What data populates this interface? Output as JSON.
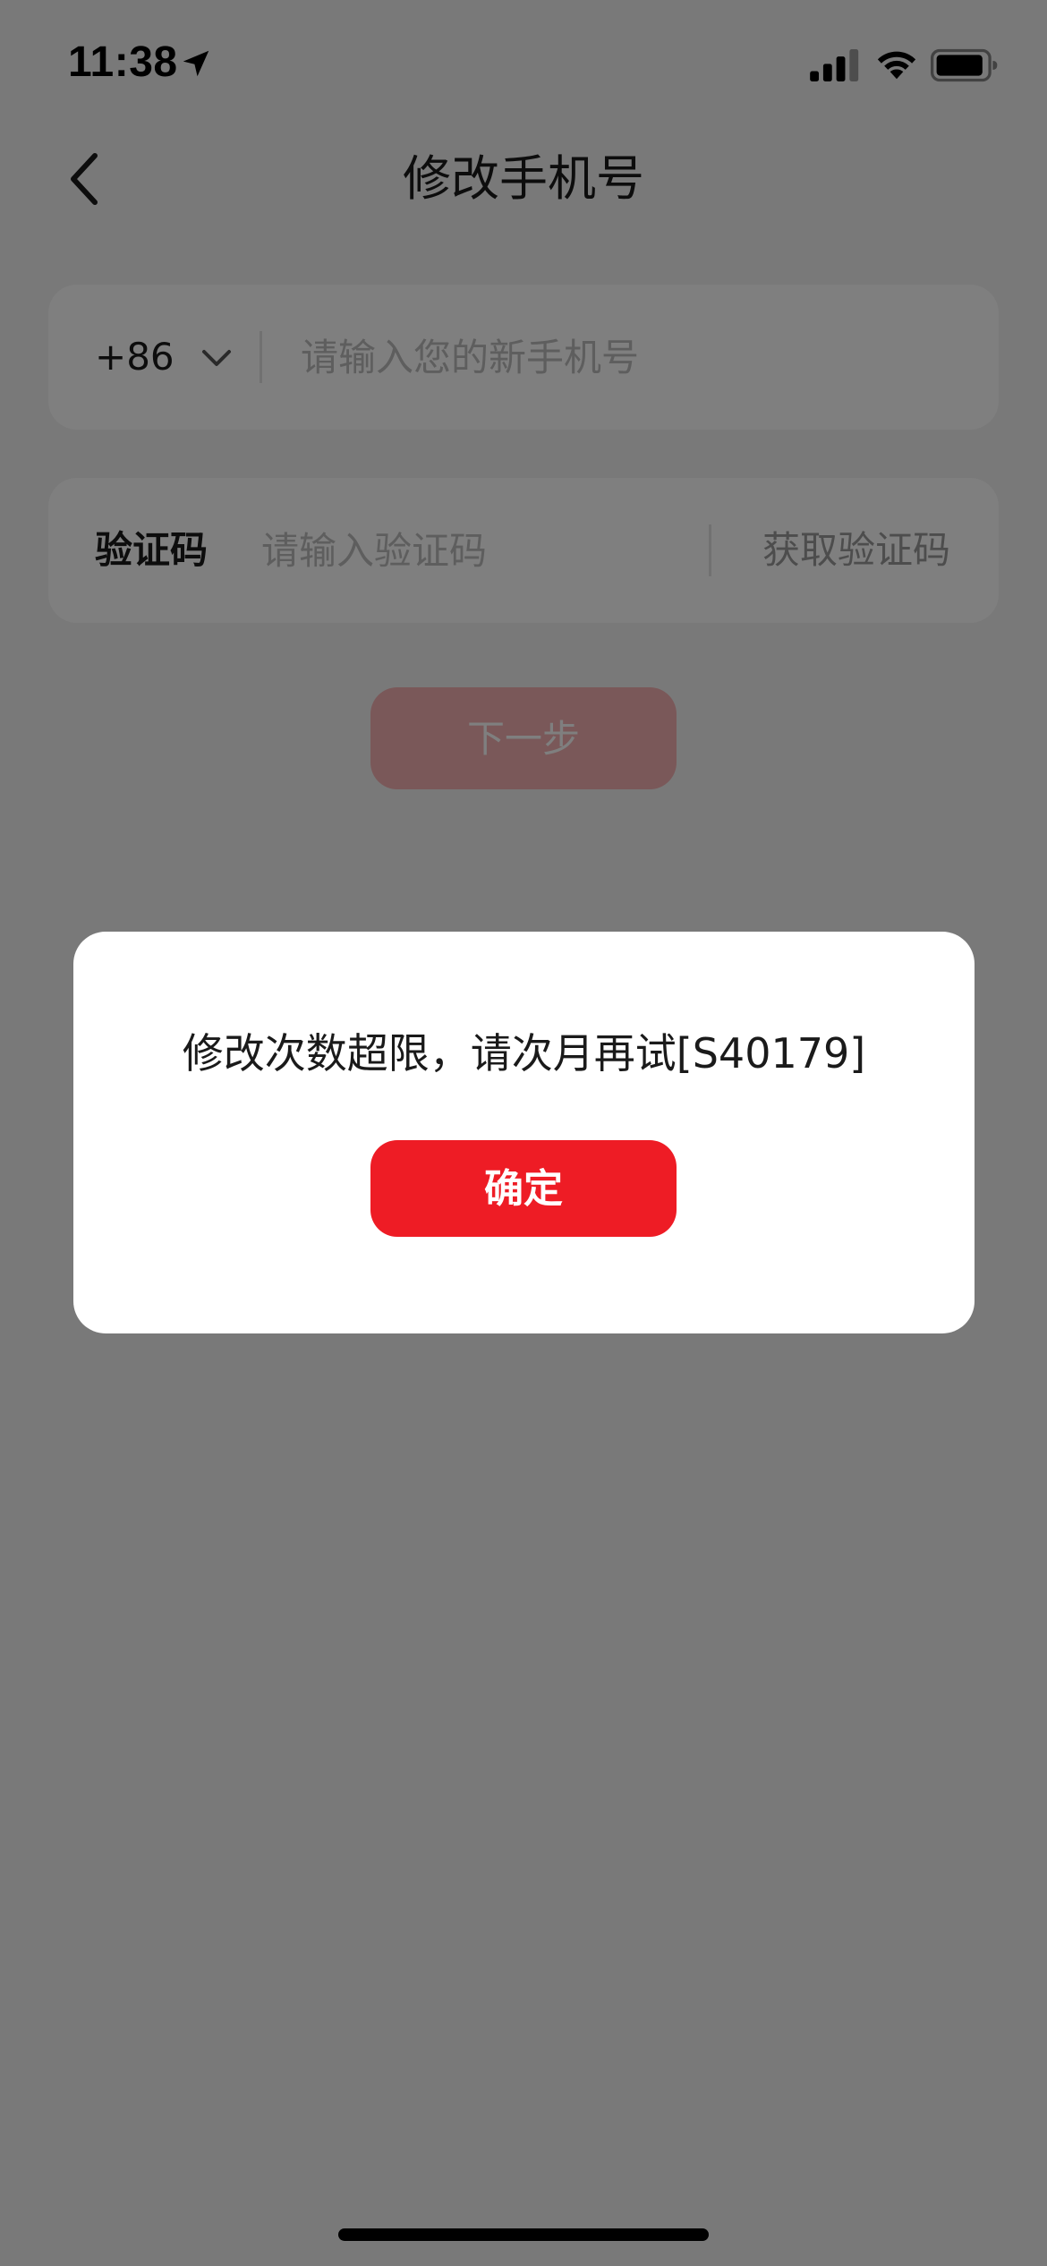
{
  "status_bar": {
    "time": "11:38",
    "icons": [
      "location-arrow-icon",
      "cellular-signal-icon",
      "wifi-icon",
      "battery-icon"
    ]
  },
  "nav": {
    "title": "修改手机号",
    "back_icon": "chevron-left-icon"
  },
  "phone_form": {
    "country_code": "+86",
    "dropdown_icon": "chevron-down-icon",
    "phone_placeholder": "请输入您的新手机号"
  },
  "code_form": {
    "label": "验证码",
    "code_placeholder": "请输入验证码",
    "get_code_label": "获取验证码"
  },
  "next_button_label": "下一步",
  "dialog": {
    "message": "修改次数超限，请次月再试[S40179]",
    "confirm_label": "确定"
  },
  "colors": {
    "accent": "#ee1c25",
    "disabled_button": "#f5b0b2",
    "background": "#f2f2f2",
    "overlay": "rgba(0,0,0,0.5)"
  }
}
